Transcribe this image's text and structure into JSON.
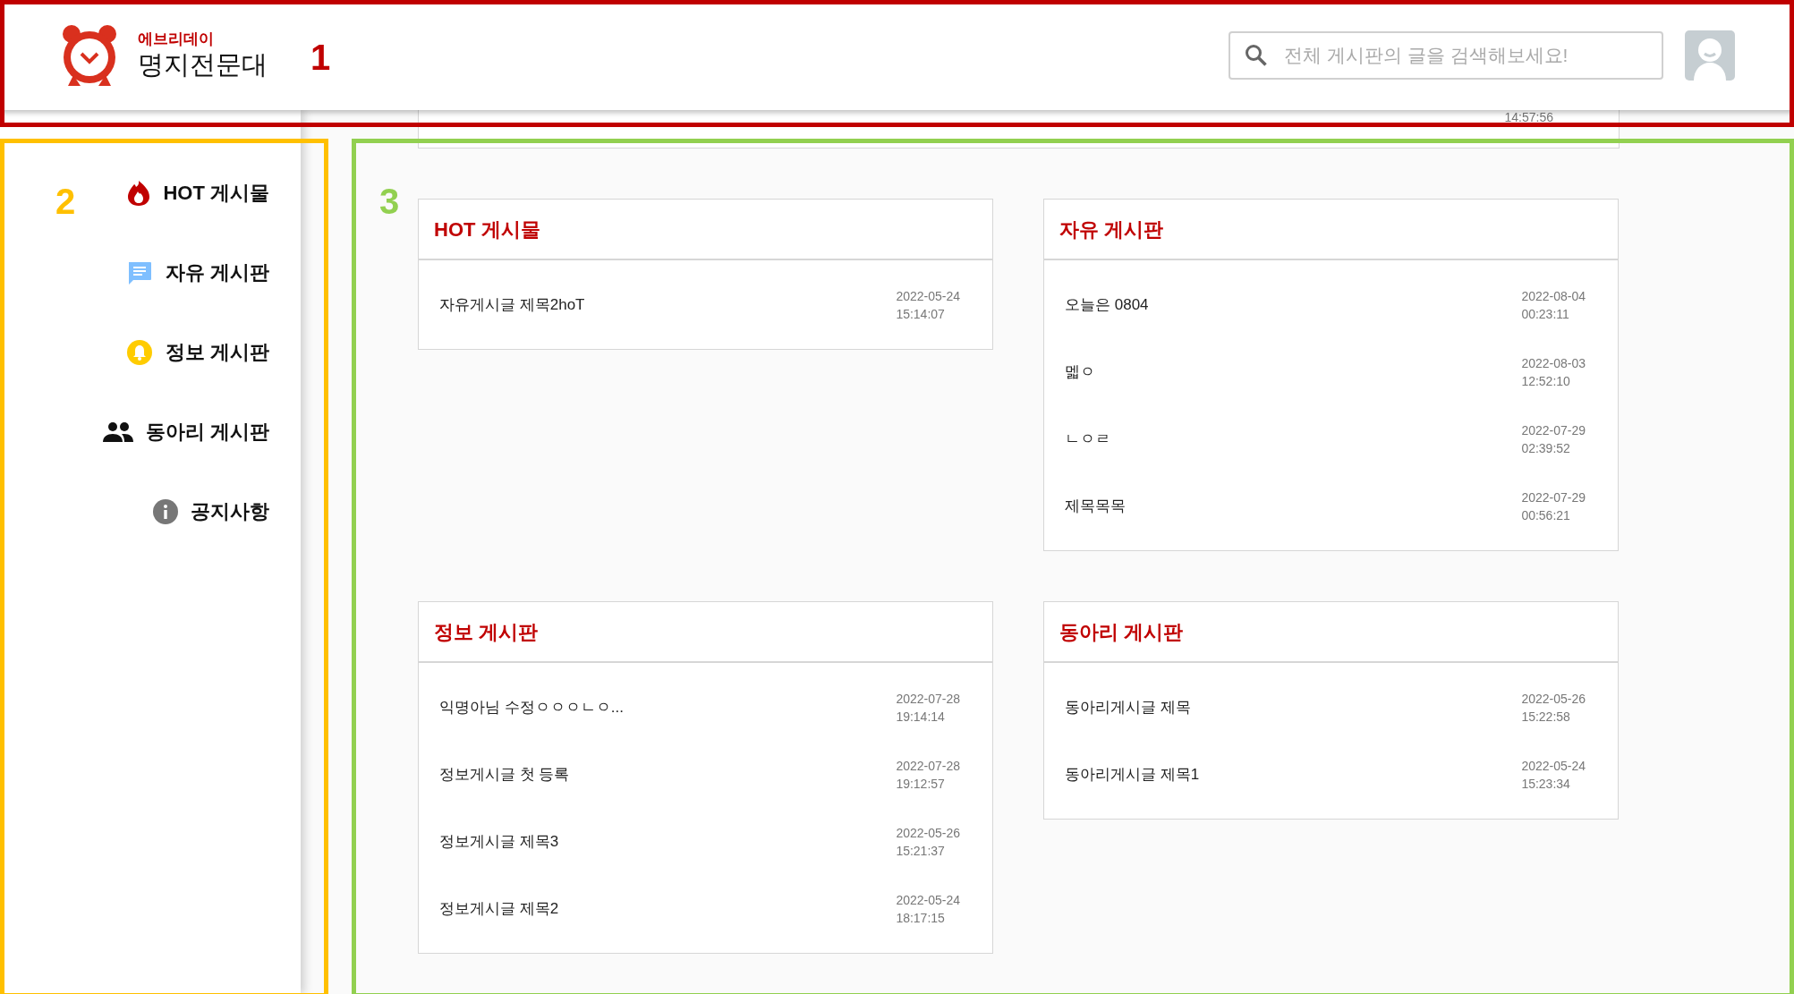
{
  "header": {
    "brand_top": "에브리데이",
    "brand_name": "명지전문대",
    "search": {
      "placeholder": "전체 게시판의 글을 검색해보세요!"
    }
  },
  "sidebar": {
    "items": [
      {
        "kind": "hot",
        "label": "HOT 게시물"
      },
      {
        "kind": "free",
        "label": "자유 게시판"
      },
      {
        "kind": "info",
        "label": "정보 게시판"
      },
      {
        "kind": "club",
        "label": "동아리 게시판"
      },
      {
        "kind": "notice",
        "label": "공지사항"
      }
    ]
  },
  "partial_post": {
    "time": "14:57:56"
  },
  "boards": [
    {
      "title": "HOT 게시물",
      "posts": [
        {
          "title": "자유게시글 제목2hoT",
          "date": "2022-05-24",
          "time": "15:14:07"
        }
      ]
    },
    {
      "title": "자유 게시판",
      "posts": [
        {
          "title": "오늘은 0804",
          "date": "2022-08-04",
          "time": "00:23:11"
        },
        {
          "title": "멟ㅇ",
          "date": "2022-08-03",
          "time": "12:52:10"
        },
        {
          "title": "ㄴㅇㄹ",
          "date": "2022-07-29",
          "time": "02:39:52"
        },
        {
          "title": "제목목목",
          "date": "2022-07-29",
          "time": "00:56:21"
        }
      ]
    },
    {
      "title": "정보 게시판",
      "posts": [
        {
          "title": "익명아님 수정ㅇㅇㅇㄴㅇ...",
          "date": "2022-07-28",
          "time": "19:14:14"
        },
        {
          "title": "정보게시글 첫 등록",
          "date": "2022-07-28",
          "time": "19:12:57"
        },
        {
          "title": "정보게시글 제목3",
          "date": "2022-05-26",
          "time": "15:21:37"
        },
        {
          "title": "정보게시글 제목2",
          "date": "2022-05-24",
          "time": "18:17:15"
        }
      ]
    },
    {
      "title": "동아리 게시판",
      "posts": [
        {
          "title": "동아리게시글 제목",
          "date": "2022-05-26",
          "time": "15:22:58"
        },
        {
          "title": "동아리게시글 제목1",
          "date": "2022-05-24",
          "time": "15:23:34"
        }
      ]
    }
  ],
  "annotations": [
    {
      "label": "1",
      "color": "#c00000"
    },
    {
      "label": "2",
      "color": "#ffc000"
    },
    {
      "label": "3",
      "color": "#92d050"
    }
  ]
}
